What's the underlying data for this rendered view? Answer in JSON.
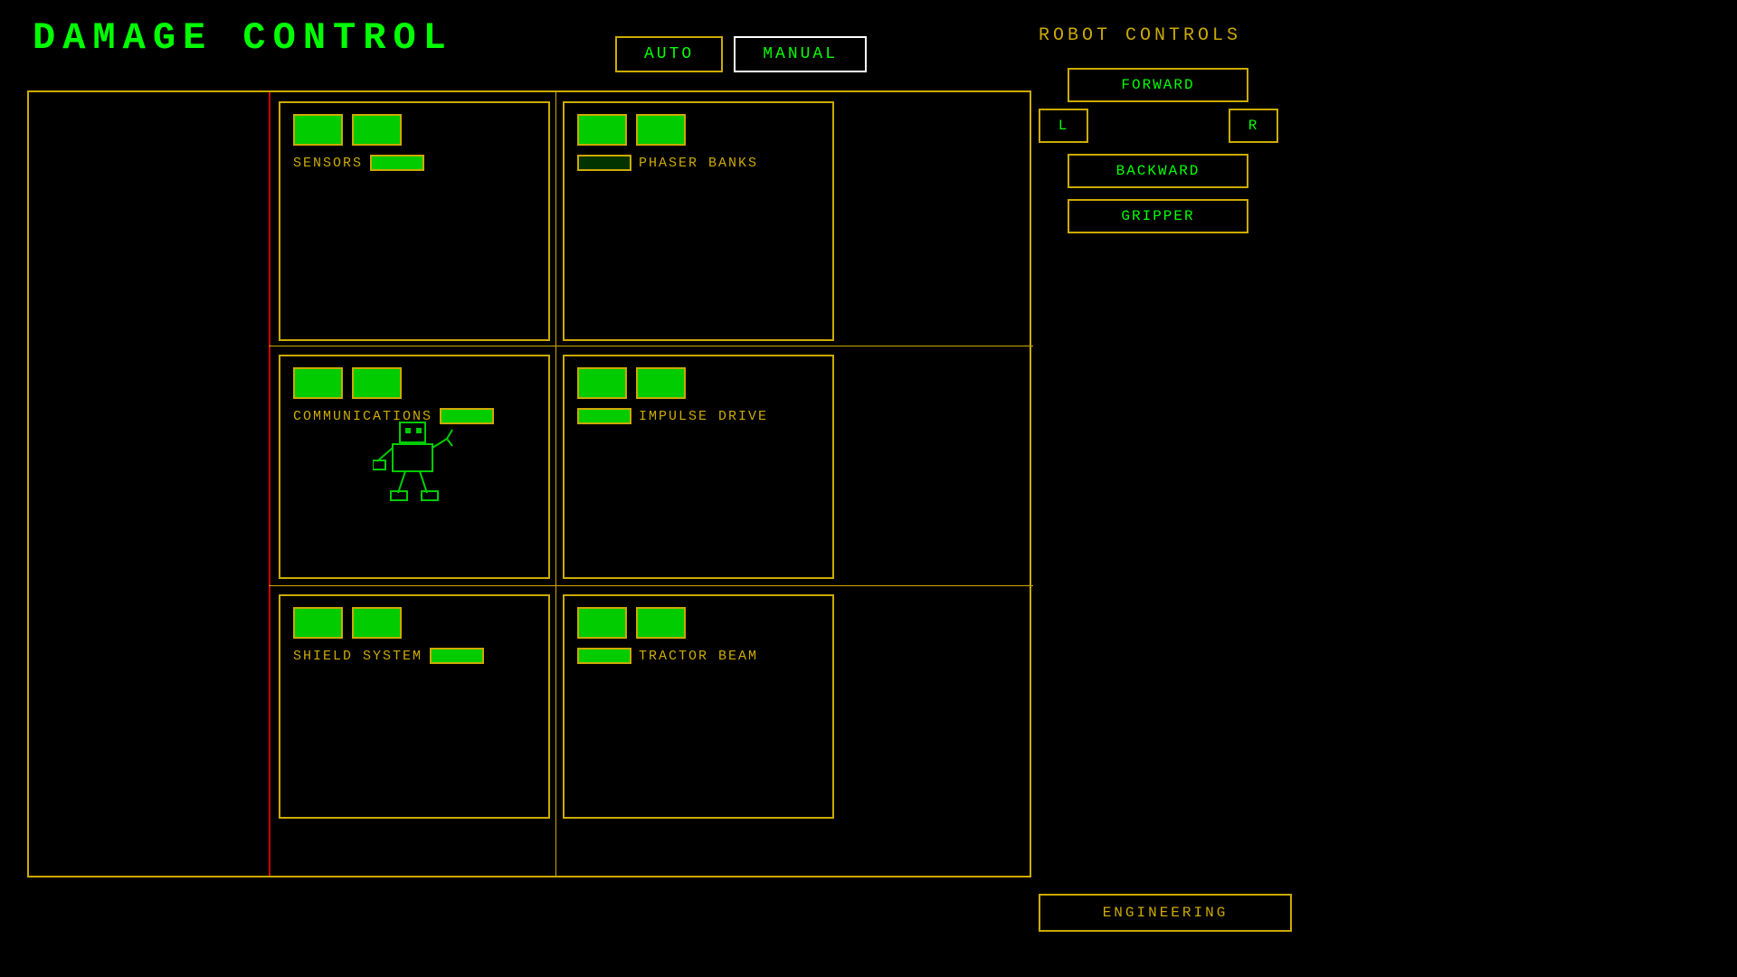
{
  "title": "DAMAGE  CONTROL",
  "mode_buttons": {
    "auto": "AUTO",
    "manual": "MANUAL"
  },
  "robot_controls": {
    "label": "ROBOT  CONTROLS",
    "forward": "FORWARD",
    "left": "L",
    "right": "R",
    "backward": "BACKWARD",
    "gripper": "GRIPPER"
  },
  "engineering": "ENGINEERING",
  "stations": [
    {
      "id": "sensors",
      "label": "SENSORS",
      "col": 0,
      "row": 0
    },
    {
      "id": "phaser-banks",
      "label": "PHASER  BANKS",
      "col": 1,
      "row": 0
    },
    {
      "id": "communications",
      "label": "COMMUNICATIONS",
      "col": 0,
      "row": 1
    },
    {
      "id": "impulse-drive",
      "label": "IMPULSE  DRIVE",
      "col": 1,
      "row": 1
    },
    {
      "id": "shield-system",
      "label": "SHIELD  SYSTEM",
      "col": 0,
      "row": 2
    },
    {
      "id": "tractor-beam",
      "label": "TRACTOR  BEAM",
      "col": 1,
      "row": 2
    }
  ]
}
